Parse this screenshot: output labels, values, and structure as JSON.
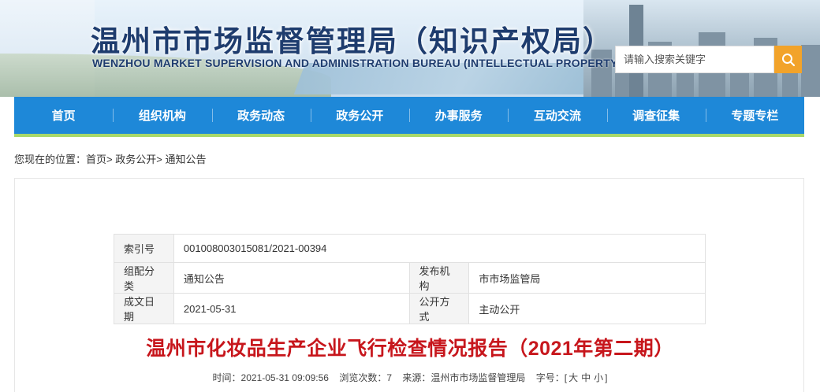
{
  "header": {
    "title_cn": "温州市市场监督管理局（知识产权局）",
    "title_en": "WENZHOU MARKET SUPERVISION AND ADMINISTRATION BUREAU (INTELLECTUAL PROPERTY OFFICE)",
    "search_placeholder": "请输入搜索关键字",
    "search_icon": "search-icon"
  },
  "nav": {
    "items": [
      "首页",
      "组织机构",
      "政务动态",
      "政务公开",
      "办事服务",
      "互动交流",
      "调查征集",
      "专题专栏"
    ],
    "color": "#1e88d8",
    "accent": "#a8d86a"
  },
  "breadcrumb": {
    "prefix": "您现在的位置：",
    "items": [
      "首页",
      "政务公开",
      "通知公告"
    ],
    "separator": ">"
  },
  "meta": {
    "index_label": "索引号",
    "index_value": "001008003015081/2021-00394",
    "category_label": "组配分类",
    "category_value": "通知公告",
    "publisher_label": "发布机构",
    "publisher_value": "市市场监管局",
    "date_label": "成文日期",
    "date_value": "2021-05-31",
    "disclosure_label": "公开方式",
    "disclosure_value": "主动公开"
  },
  "article": {
    "title": "温州市化妆品生产企业飞行检查情况报告（2021年第二期）",
    "title_color": "#c7161c",
    "time": "时间：2021-05-31 09:09:56",
    "views": "浏览次数：7",
    "source": "来源：温州市市场监督管理局",
    "font_label": "字号：[",
    "font_large": "大",
    "font_medium": "中",
    "font_small": "小",
    "font_close": "]"
  }
}
